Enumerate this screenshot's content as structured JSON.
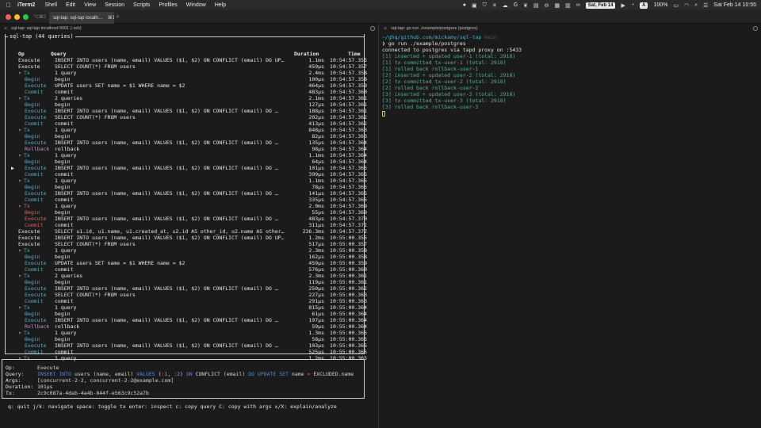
{
  "menubar": {
    "app_name": "iTerm2",
    "menus": [
      "Shell",
      "Edit",
      "View",
      "Session",
      "Scripts",
      "Profiles",
      "Window",
      "Help"
    ],
    "date_pill": "Sat, Feb 14",
    "letter_pill": "A",
    "battery": "100%",
    "clock": "Sat Feb 14  10:55"
  },
  "tabbar": {
    "left_shortcut": "⌥⌘2",
    "active_tab": "sql-tap: sql-tap localh…",
    "active_shortcut": "⌘1",
    "plus": "+"
  },
  "left_pane": {
    "title": "sql-tap: sql-tap localhost:9091 (-zsh)",
    "tui_title": "sql-tap (44 queries)",
    "columns": {
      "op": "Op",
      "query": "Query",
      "duration": "Duration",
      "time": "Time"
    },
    "rows": [
      {
        "cursor": "",
        "tri": "",
        "op": "Execute",
        "cls": "op-top",
        "indent": 0,
        "query": "INSERT INTO users (name, email) VALUES ($1, $2) ON CONFLICT (email) DO UP…",
        "dur": "1.1ms",
        "time": "10:54:57.355"
      },
      {
        "cursor": "",
        "tri": "",
        "op": "Execute",
        "cls": "op-top",
        "indent": 0,
        "query": "SELECT COUNT(*) FROM users",
        "dur": "459µs",
        "time": "10:54:57.357"
      },
      {
        "cursor": "",
        "tri": "▾",
        "op": "Tx",
        "cls": "op-tx",
        "indent": 0,
        "query": "1 query",
        "dur": "2.4ms",
        "time": "10:54:57.358"
      },
      {
        "cursor": "",
        "tri": "",
        "op": "Begin",
        "cls": "op-begin",
        "indent": 1,
        "query": "begin",
        "dur": "100µs",
        "time": "10:54:57.358"
      },
      {
        "cursor": "",
        "tri": "",
        "op": "Execute",
        "cls": "op-execute",
        "indent": 1,
        "query": "UPDATE users SET name = $1 WHERE name = $2",
        "dur": "464µs",
        "time": "10:54:57.359"
      },
      {
        "cursor": "",
        "tri": "",
        "op": "Commit",
        "cls": "op-commit",
        "indent": 1,
        "query": "commit",
        "dur": "483µs",
        "time": "10:54:57.360"
      },
      {
        "cursor": "",
        "tri": "▾",
        "op": "Tx",
        "cls": "op-tx",
        "indent": 0,
        "query": "2 queries",
        "dur": "2.1ms",
        "time": "10:54:57.361"
      },
      {
        "cursor": "",
        "tri": "",
        "op": "Begin",
        "cls": "op-begin",
        "indent": 1,
        "query": "begin",
        "dur": "127µs",
        "time": "10:54:57.361"
      },
      {
        "cursor": "",
        "tri": "",
        "op": "Execute",
        "cls": "op-execute",
        "indent": 1,
        "query": "INSERT INTO users (name, email) VALUES ($1, $2) ON CONFLICT (email) DO …",
        "dur": "188µs",
        "time": "10:54:57.361"
      },
      {
        "cursor": "",
        "tri": "",
        "op": "Execute",
        "cls": "op-execute",
        "indent": 1,
        "query": "SELECT COUNT(*) FROM users",
        "dur": "202µs",
        "time": "10:54:57.362"
      },
      {
        "cursor": "",
        "tri": "",
        "op": "Commit",
        "cls": "op-commit",
        "indent": 1,
        "query": "commit",
        "dur": "413µs",
        "time": "10:54:57.362"
      },
      {
        "cursor": "",
        "tri": "▾",
        "op": "Tx",
        "cls": "op-tx",
        "indent": 0,
        "query": "1 query",
        "dur": "848µs",
        "time": "10:54:57.363"
      },
      {
        "cursor": "",
        "tri": "",
        "op": "Begin",
        "cls": "op-begin",
        "indent": 1,
        "query": "begin",
        "dur": "82µs",
        "time": "10:54:57.363"
      },
      {
        "cursor": "",
        "tri": "",
        "op": "Execute",
        "cls": "op-execute",
        "indent": 1,
        "query": "INSERT INTO users (name, email) VALUES ($1, $2) ON CONFLICT (email) DO …",
        "dur": "135µs",
        "time": "10:54:57.364"
      },
      {
        "cursor": "",
        "tri": "",
        "op": "Rollback",
        "cls": "op-rollback",
        "indent": 1,
        "query": "rollback",
        "dur": "98µs",
        "time": "10:54:57.364"
      },
      {
        "cursor": "",
        "tri": "▾",
        "op": "Tx",
        "cls": "op-tx",
        "indent": 0,
        "query": "1 query",
        "dur": "1.1ms",
        "time": "10:54:57.364"
      },
      {
        "cursor": "",
        "tri": "",
        "op": "Begin",
        "cls": "op-begin",
        "indent": 1,
        "query": "begin",
        "dur": "64µs",
        "time": "10:54:57.364"
      },
      {
        "cursor": "▶",
        "tri": "",
        "op": "Execute",
        "cls": "op-execute",
        "indent": 1,
        "query": "INSERT INTO users (name, email) VALUES ($1, $2) ON CONFLICT (email) DO …",
        "dur": "101µs",
        "time": "10:54:57.365"
      },
      {
        "cursor": "",
        "tri": "",
        "op": "Commit",
        "cls": "op-commit",
        "indent": 1,
        "query": "commit",
        "dur": "399µs",
        "time": "10:54:57.365"
      },
      {
        "cursor": "",
        "tri": "▾",
        "op": "Tx",
        "cls": "op-tx",
        "indent": 0,
        "query": "1 query",
        "dur": "1.1ms",
        "time": "10:54:57.365"
      },
      {
        "cursor": "",
        "tri": "",
        "op": "Begin",
        "cls": "op-begin",
        "indent": 1,
        "query": "begin",
        "dur": "78µs",
        "time": "10:54:57.365"
      },
      {
        "cursor": "",
        "tri": "",
        "op": "Execute",
        "cls": "op-execute",
        "indent": 1,
        "query": "INSERT INTO users (name, email) VALUES ($1, $2) ON CONFLICT (email) DO …",
        "dur": "141µs",
        "time": "10:54:57.365"
      },
      {
        "cursor": "",
        "tri": "",
        "op": "Commit",
        "cls": "op-commit",
        "indent": 1,
        "query": "commit",
        "dur": "335µs",
        "time": "10:54:57.365"
      },
      {
        "cursor": "",
        "tri": "▾",
        "op": "Tx",
        "cls": "op-tx-red",
        "indent": 0,
        "query": "1 query",
        "dur": "2.0ms",
        "time": "10:54:57.369"
      },
      {
        "cursor": "",
        "tri": "",
        "op": "Begin",
        "cls": "op-red",
        "indent": 1,
        "query": "begin",
        "dur": "55µs",
        "time": "10:54:57.369"
      },
      {
        "cursor": "",
        "tri": "",
        "op": "Execute",
        "cls": "op-red",
        "indent": 1,
        "query": "INSERT INTO users (name, email) VALUES ($1, $2) ON CONFLICT (email) DO …",
        "dur": "483µs",
        "time": "10:54:57.370"
      },
      {
        "cursor": "",
        "tri": "",
        "op": "Commit",
        "cls": "op-red",
        "indent": 1,
        "query": "commit",
        "dur": "311µs",
        "time": "10:54:57.371"
      },
      {
        "cursor": "",
        "tri": "",
        "op": "Execute",
        "cls": "op-top",
        "indent": 0,
        "query": "SELECT u1.id, u1.name, u1.created_at, u2.id AS other_id, u2.name AS other…",
        "dur": "236.3ms",
        "time": "10:54:57.372"
      },
      {
        "cursor": "",
        "tri": "",
        "op": "Execute",
        "cls": "op-top",
        "indent": 0,
        "query": "INSERT INTO users (name, email) VALUES ($1, $2) ON CONFLICT (email) DO UP…",
        "dur": "1.2ms",
        "time": "10:55:00.355"
      },
      {
        "cursor": "",
        "tri": "",
        "op": "Execute",
        "cls": "op-top",
        "indent": 0,
        "query": "SELECT COUNT(*) FROM users",
        "dur": "517µs",
        "time": "10:55:00.357"
      },
      {
        "cursor": "",
        "tri": "▾",
        "op": "Tx",
        "cls": "op-tx",
        "indent": 0,
        "query": "1 query",
        "dur": "2.3ms",
        "time": "10:55:00.358"
      },
      {
        "cursor": "",
        "tri": "",
        "op": "Begin",
        "cls": "op-begin",
        "indent": 1,
        "query": "begin",
        "dur": "162µs",
        "time": "10:55:00.358"
      },
      {
        "cursor": "",
        "tri": "",
        "op": "Execute",
        "cls": "op-execute",
        "indent": 1,
        "query": "UPDATE users SET name = $1 WHERE name = $2",
        "dur": "459µs",
        "time": "10:55:00.359"
      },
      {
        "cursor": "",
        "tri": "",
        "op": "Commit",
        "cls": "op-commit",
        "indent": 1,
        "query": "commit",
        "dur": "576µs",
        "time": "10:55:00.360"
      },
      {
        "cursor": "",
        "tri": "▾",
        "op": "Tx",
        "cls": "op-tx",
        "indent": 0,
        "query": "2 queries",
        "dur": "2.3ms",
        "time": "10:55:00.361"
      },
      {
        "cursor": "",
        "tri": "",
        "op": "Begin",
        "cls": "op-begin",
        "indent": 1,
        "query": "begin",
        "dur": "119µs",
        "time": "10:55:00.361"
      },
      {
        "cursor": "",
        "tri": "",
        "op": "Execute",
        "cls": "op-execute",
        "indent": 1,
        "query": "INSERT INTO users (name, email) VALUES ($1, $2) ON CONFLICT (email) DO …",
        "dur": "250µs",
        "time": "10:55:00.362"
      },
      {
        "cursor": "",
        "tri": "",
        "op": "Execute",
        "cls": "op-execute",
        "indent": 1,
        "query": "SELECT COUNT(*) FROM users",
        "dur": "227µs",
        "time": "10:55:00.363"
      },
      {
        "cursor": "",
        "tri": "",
        "op": "Commit",
        "cls": "op-commit",
        "indent": 1,
        "query": "commit",
        "dur": "291µs",
        "time": "10:55:00.363"
      },
      {
        "cursor": "",
        "tri": "▾",
        "op": "Tx",
        "cls": "op-tx",
        "indent": 0,
        "query": "1 query",
        "dur": "815µs",
        "time": "10:55:00.364"
      },
      {
        "cursor": "",
        "tri": "",
        "op": "Begin",
        "cls": "op-begin",
        "indent": 1,
        "query": "begin",
        "dur": "61µs",
        "time": "10:55:00.364"
      },
      {
        "cursor": "",
        "tri": "",
        "op": "Execute",
        "cls": "op-execute",
        "indent": 1,
        "query": "INSERT INTO users (name, email) VALUES ($1, $2) ON CONFLICT (email) DO …",
        "dur": "197µs",
        "time": "10:55:00.364"
      },
      {
        "cursor": "",
        "tri": "",
        "op": "Rollback",
        "cls": "op-rollback",
        "indent": 1,
        "query": "rollback",
        "dur": "59µs",
        "time": "10:55:00.364"
      },
      {
        "cursor": "",
        "tri": "▾",
        "op": "Tx",
        "cls": "op-tx",
        "indent": 0,
        "query": "1 query",
        "dur": "1.3ms",
        "time": "10:55:00.365"
      },
      {
        "cursor": "",
        "tri": "",
        "op": "Begin",
        "cls": "op-begin",
        "indent": 1,
        "query": "begin",
        "dur": "58µs",
        "time": "10:55:00.365"
      },
      {
        "cursor": "",
        "tri": "",
        "op": "Execute",
        "cls": "op-execute",
        "indent": 1,
        "query": "INSERT INTO users (name, email) VALUES ($1, $2) ON CONFLICT (email) DO …",
        "dur": "103µs",
        "time": "10:55:00.365"
      },
      {
        "cursor": "",
        "tri": "",
        "op": "Commit",
        "cls": "op-commit",
        "indent": 1,
        "query": "commit",
        "dur": "525µs",
        "time": "10:55:00.365"
      },
      {
        "cursor": "",
        "tri": "▾",
        "op": "Tx",
        "cls": "op-tx",
        "indent": 0,
        "query": "1 query",
        "dur": "1.2ms",
        "time": "10:55:00.365"
      }
    ],
    "detail": {
      "op_label": "Op:",
      "op_value": "Execute",
      "query_label": "Query:",
      "query_parts": {
        "kw_insert": "INSERT INTO",
        "t1": " users (name, email) ",
        "kw_values": "VALUES",
        "t2": " (",
        "p1": ":1",
        "t3": ", ",
        "p2": ":2",
        "t4": ") ",
        "kw_on": "ON",
        "t5": " CONFLICT (email) ",
        "kw_do": "DO UPDATE SET",
        "t6": " name ",
        "eq": "=",
        "t7": " EXCLUDED.name"
      },
      "args_label": "Args:",
      "args_value": "[concurrent-2-2, concurrent-2-2@example.com]",
      "duration_label": "Duration:",
      "duration_value": "101µs",
      "tx_label": "Tx:",
      "tx_value": "2c9c087a-4dab-4a4b-844f-e563c9c52a7b"
    },
    "help": "q: quit  j/k: navigate  space: toggle tx  enter: inspect  c: copy query  C: copy with args  x/X: explain/analyze"
  },
  "right_pane": {
    "title": "sql-tap: go run ./example/postgres (postgres)",
    "path": "~/ghq/github.com/mickamy/sql-tap",
    "branch": "main",
    "prompt_symbol": "❯",
    "command": "go run ./example/postgres",
    "lines": [
      "connected to postgres via tapd proxy on :5433",
      "[1] inserted + updated user-1 (total: 2918)",
      "[1] tx committed tx-user-1 (total: 2918)",
      "[1] rolled back rollback-user-1",
      "[2] inserted + updated user-2 (total: 2918)",
      "[2] tx committed tx-user-2 (total: 2918)",
      "[2] rolled back rollback-user-2",
      "[3] inserted + updated user-3 (total: 2918)",
      "[3] tx committed tx-user-3 (total: 2918)",
      "[3] rolled back rollback-user-3"
    ]
  },
  "colors": {
    "accent_cyan": "#4fb0c6",
    "error_red": "#e06060",
    "rollback_purple": "#c389e6",
    "keyword_blue": "#4a8cf0",
    "output_green": "#4fb09a"
  }
}
